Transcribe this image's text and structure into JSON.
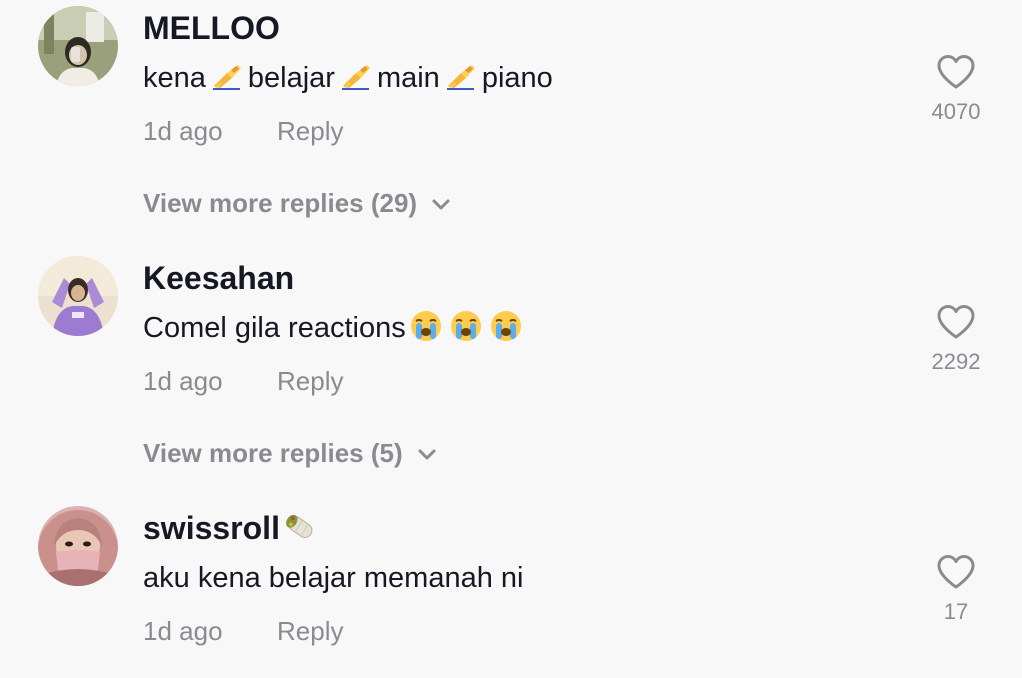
{
  "comments": [
    {
      "username": "MELLOO",
      "text_parts": [
        "kena",
        "belajar",
        "main",
        "piano"
      ],
      "emoji": "writing-hand",
      "time": "1d ago",
      "reply_label": "Reply",
      "likes": "4070",
      "more_replies": "View more replies (29)"
    },
    {
      "username": "Keesahan",
      "text": "Comel gila reactions",
      "emoji": "loudly-crying-face",
      "time": "1d ago",
      "reply_label": "Reply",
      "likes": "2292",
      "more_replies": "View more replies (5)"
    },
    {
      "username": "swissroll",
      "username_emoji": "burrito",
      "text": "aku kena belajar memanah ni",
      "time": "1d ago",
      "reply_label": "Reply",
      "likes": "17"
    }
  ]
}
